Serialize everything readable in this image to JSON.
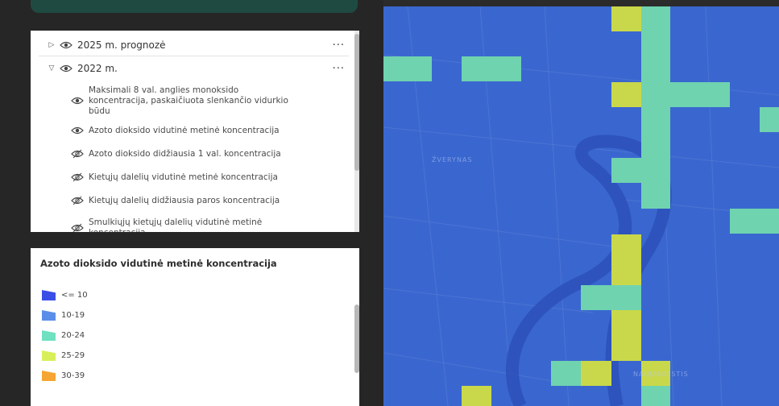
{
  "layers": {
    "groups": [
      {
        "label": "2025 m. prognozė",
        "expanded": false,
        "more": "···"
      },
      {
        "label": "2022 m.",
        "expanded": true,
        "more": "···"
      }
    ],
    "sublayers": [
      {
        "label": "Maksimali 8 val. anglies monoksido koncentracija, paskaičiuota slenkančio vidurkio būdu",
        "more": "···"
      },
      {
        "label": "Azoto dioksido vidutinė metinė koncentracija",
        "more": "···"
      },
      {
        "label": "Azoto dioksido didžiausia 1 val. koncentracija",
        "more": "···"
      },
      {
        "label": "Kietųjų dalelių vidutinė metinė koncentracija",
        "more": "···"
      },
      {
        "label": "Kietųjų dalelių didžiausia paros koncentracija",
        "more": "···"
      },
      {
        "label": "Smulkiųjų kietųjų dalelių vidutinė metinė koncentracija",
        "more": "···"
      }
    ]
  },
  "legend": {
    "title": "Azoto dioksido vidutinė metinė koncentracija",
    "items": [
      {
        "label": "<= 10",
        "color": "#3a4fe6"
      },
      {
        "label": "10-19",
        "color": "#5b8ee8"
      },
      {
        "label": "20-24",
        "color": "#6fe0c0"
      },
      {
        "label": "25-29",
        "color": "#d9ef5a"
      },
      {
        "label": "30-39",
        "color": "#f5a532"
      }
    ]
  },
  "map": {
    "labels": [
      {
        "text": "ŽVERYNAS"
      },
      {
        "text": "NAUJAMIESTIS"
      }
    ],
    "colors": {
      "base": "#3a67cf",
      "cell_low": "#6fd3b0",
      "cell_mid": "#c9d84a"
    }
  }
}
